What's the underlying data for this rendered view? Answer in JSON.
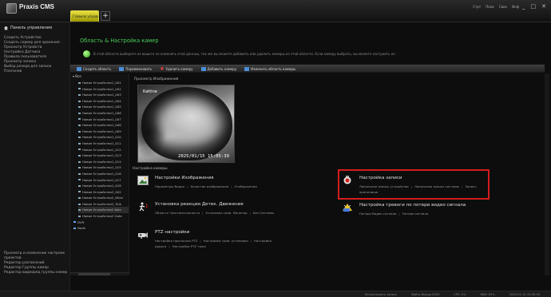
{
  "app": {
    "title": "Praxis CMS",
    "subtitle": "",
    "tab_label": "Главная управл.",
    "add_tab": "+"
  },
  "window_menu": [
    "Стрт",
    "Помс",
    "Свое",
    "Инф"
  ],
  "window_buttons": [
    "_",
    "□",
    "✕"
  ],
  "sidebar": {
    "header": "Панель управления",
    "items": [
      "Создать Устройство",
      "Создать сервер для хранения",
      "Просмотр Устройств",
      "Настройка Датчика",
      "Правила пользователя",
      "Просмотр записи",
      "Выбор резерв для записи",
      "Плагинов"
    ],
    "bottom_items": [
      "Просмотр и изменение настроек проектов",
      "Редактор расписаний",
      "Редактор Группы камер",
      "Редактор видеоряд группы камер"
    ]
  },
  "main": {
    "title": "Область & Настройка камер",
    "info": "В этой области выберите из вашего не изменить этой данных, так же вы можете добавить или удалить камеры из этой области. Если камеру выбрать, вы можете настроить ее."
  },
  "toolbar": {
    "create_area": "Создать область",
    "rename": "Переименовать",
    "delete_camera": "Удалить камеру",
    "add_camera": "Добавить камеру",
    "change_area": "Изменить область камеры"
  },
  "tree": {
    "root": "Все",
    "items": [
      "Новое Устройство1_001",
      "Новое Устройство1_002",
      "Новое Устройство1_003",
      "Новое Устройство1_004",
      "Новое Устройство1_005",
      "Новое Устройство1_006",
      "Новое Устройство1_007",
      "Новое Устройство1_008",
      "Новое Устройство1_009",
      "Новое Устройство1_010",
      "Новое Устройство1_011",
      "Новое Устройство1_012",
      "Новое Устройство1_013",
      "Новое Устройство1_014",
      "Новое Устройство1_015",
      "Новое Устройство1_016",
      "Новое Устройство1_017",
      "Новое Устройство1_018",
      "Новое Устройство2_002",
      "Новое Устройство2_Wlan",
      "Новое Устройство2_Tuik",
      "Новое Устройство2 Kole",
      "Новое Устройство2 Gate"
    ],
    "extra": [
      "DVR",
      "Node"
    ]
  },
  "preview": {
    "label": "Просмотр Изображения",
    "camera_name": "Kattine",
    "timestamp": "2025/01/15 15:05:39"
  },
  "settings_label": "Настройка камеры",
  "groups": [
    {
      "title": "Настройки Изображения",
      "links": [
        "Параметры Видео",
        "Качество изображения",
        "Отображение"
      ]
    },
    {
      "title": "Установка реакции Детек. Движения",
      "links": [
        "Область Чувствительности",
        "Установка трев. Монитор",
        "Без Системы"
      ]
    },
    {
      "title": "PTZ настройки",
      "links": [
        "Настройка протокола PTZ",
        "Настройка трев. установки",
        "Настройка дорога",
        "Настройка PTZ тоже"
      ]
    },
    {
      "title": "Настройка записи",
      "links": [
        "Локальная запись устройства",
        "Локальная запись системы",
        "Запись хранилище"
      ]
    },
    {
      "title": "Настройка тревоги по потери видео сигнала",
      "links": [
        "Потеря Видео сигнала",
        "Потеря сигнала"
      ]
    }
  ],
  "statusbar": [
    "Использовать запись",
    "Войти Выход 0003",
    "CPU: 2%",
    "RAM: 67%",
    "2025-01-15 15:05:39"
  ],
  "colors": {
    "accent_green": "#49d05a",
    "tab_yellow": "#e8e040",
    "highlight_red": "#d41c1c"
  }
}
